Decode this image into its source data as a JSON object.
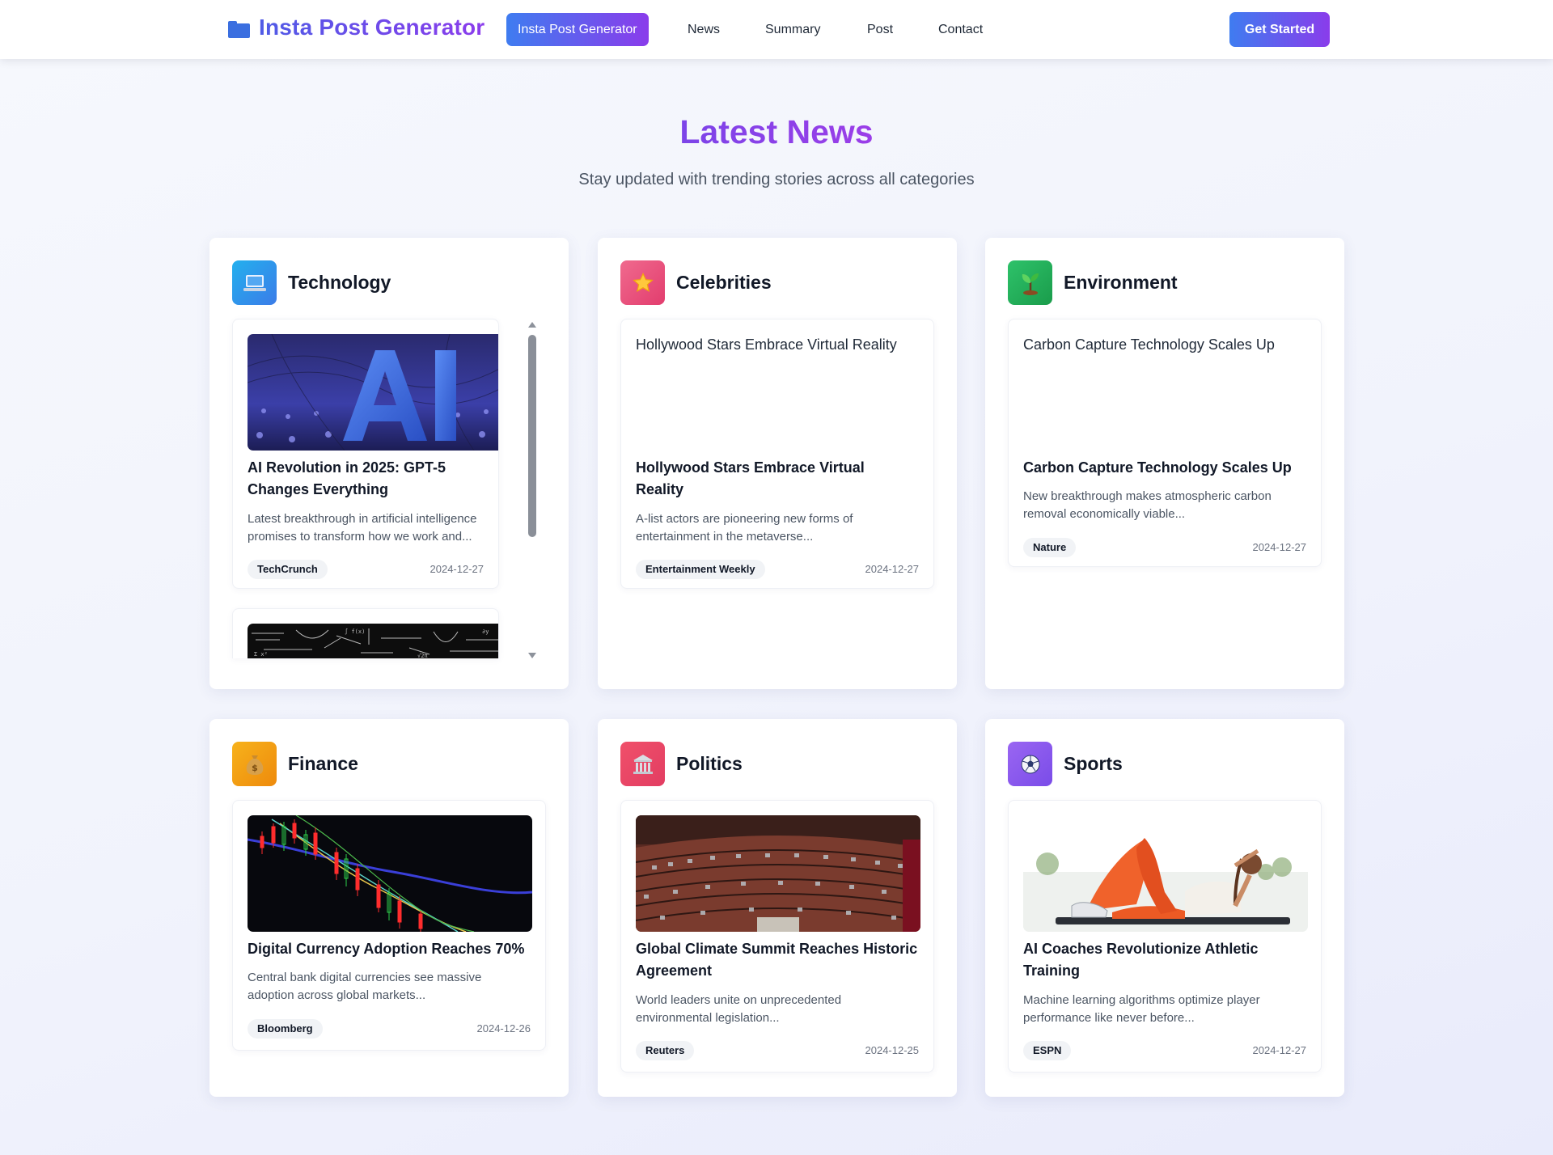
{
  "nav": {
    "brand": "Insta Post Generator",
    "links": [
      "Insta Post Generator",
      "News",
      "Summary",
      "Post",
      "Contact"
    ],
    "cta": "Get Started"
  },
  "hero": {
    "title": "Latest News",
    "subtitle": "Stay updated with trending stories across all categories"
  },
  "categories": [
    {
      "title": "Technology",
      "icon": "laptop-icon",
      "articles": [
        {
          "title": "AI Revolution in 2025: GPT-5 Changes Everything",
          "desc": "Latest breakthrough in artificial intelligence promises to transform how we work and...",
          "source": "TechCrunch",
          "date": "2024-12-27"
        }
      ]
    },
    {
      "title": "Celebrities",
      "icon": "star-icon",
      "articles": [
        {
          "image_alt": "Hollywood Stars Embrace Virtual Reality",
          "title": "Hollywood Stars Embrace Virtual Reality",
          "desc": "A-list actors are pioneering new forms of entertainment in the metaverse...",
          "source": "Entertainment Weekly",
          "date": "2024-12-27"
        }
      ]
    },
    {
      "title": "Environment",
      "icon": "seedling-icon",
      "articles": [
        {
          "image_alt": "Carbon Capture Technology Scales Up",
          "title": "Carbon Capture Technology Scales Up",
          "desc": "New breakthrough makes atmospheric carbon removal economically viable...",
          "source": "Nature",
          "date": "2024-12-27"
        }
      ]
    },
    {
      "title": "Finance",
      "icon": "money-bag-icon",
      "articles": [
        {
          "title": "Digital Currency Adoption Reaches 70%",
          "desc": "Central bank digital currencies see massive adoption across global markets...",
          "source": "Bloomberg",
          "date": "2024-12-26"
        }
      ]
    },
    {
      "title": "Politics",
      "icon": "classical-building-icon",
      "articles": [
        {
          "title": "Global Climate Summit Reaches Historic Agreement",
          "desc": "World leaders unite on unprecedented environmental legislation...",
          "source": "Reuters",
          "date": "2024-12-25"
        }
      ]
    },
    {
      "title": "Sports",
      "icon": "soccer-ball-icon",
      "articles": [
        {
          "title": "AI Coaches Revolutionize Athletic Training",
          "desc": "Machine learning algorithms optimize player performance like never before...",
          "source": "ESPN",
          "date": "2024-12-27"
        }
      ]
    }
  ],
  "colors": {
    "brand_gradient_start": "#3f7cf0",
    "brand_gradient_end": "#8a3ceb",
    "technology": "#1fa6e8",
    "celebrities": "#ec4f7e",
    "environment": "#22b35a",
    "finance": "#f2a011",
    "politics": "#ef4764",
    "sports": "#8a5cf0"
  }
}
